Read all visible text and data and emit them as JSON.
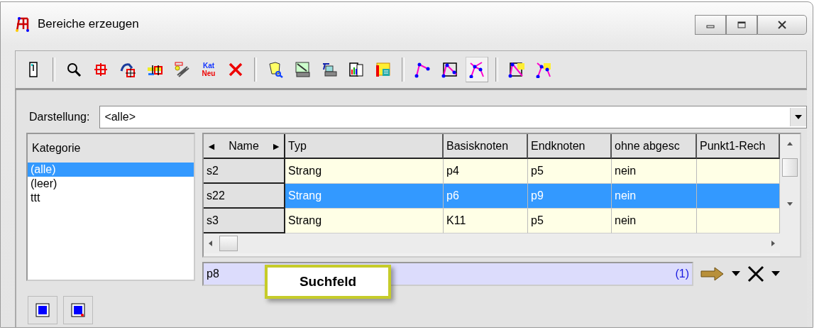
{
  "window": {
    "title": "Bereiche erzeugen"
  },
  "toolbar": [
    {
      "kind": "button",
      "selected": false
    },
    {
      "kind": "separator"
    },
    {
      "kind": "button",
      "selected": false
    },
    {
      "kind": "button",
      "selected": false
    },
    {
      "kind": "button",
      "selected": false
    },
    {
      "kind": "button",
      "selected": false
    },
    {
      "kind": "button",
      "selected": false
    },
    {
      "kind": "textbutton",
      "top": "Kat",
      "bottom": "Neu",
      "selected": false
    },
    {
      "kind": "button",
      "selected": false
    },
    {
      "kind": "separator"
    },
    {
      "kind": "button",
      "selected": false
    },
    {
      "kind": "button",
      "selected": false
    },
    {
      "kind": "button",
      "selected": false
    },
    {
      "kind": "button",
      "selected": false
    },
    {
      "kind": "button",
      "selected": false
    },
    {
      "kind": "separator"
    },
    {
      "kind": "button",
      "selected": false
    },
    {
      "kind": "button",
      "selected": false
    },
    {
      "kind": "button",
      "selected": true
    },
    {
      "kind": "separator"
    },
    {
      "kind": "button",
      "selected": false
    },
    {
      "kind": "button",
      "selected": false
    }
  ],
  "display": {
    "label": "Darstellung:",
    "value": "<alle>"
  },
  "categories": {
    "header": "Kategorie",
    "items": [
      {
        "label": "(alle)",
        "selected": true
      },
      {
        "label": "(leer)",
        "selected": false
      },
      {
        "label": "ttt",
        "selected": false
      }
    ]
  },
  "table": {
    "name_header": {
      "prev": "◄",
      "label": "Name",
      "next": "►"
    },
    "columns": [
      "Typ",
      "Basisknoten",
      "Endknoten",
      "ohne abgesc",
      "Punkt1-Rech"
    ],
    "rows": [
      {
        "name": "s2",
        "cells": [
          "Strang",
          "p4",
          "p5",
          "nein",
          ""
        ],
        "selected": false
      },
      {
        "name": "s22",
        "cells": [
          "Strang",
          "p6",
          "p9",
          "nein",
          ""
        ],
        "selected": true
      },
      {
        "name": "s3",
        "cells": [
          "Strang",
          "K11",
          "p5",
          "nein",
          ""
        ],
        "selected": false
      }
    ]
  },
  "search": {
    "value": "p8",
    "count": "(1)"
  },
  "callout": "Suchfeld"
}
